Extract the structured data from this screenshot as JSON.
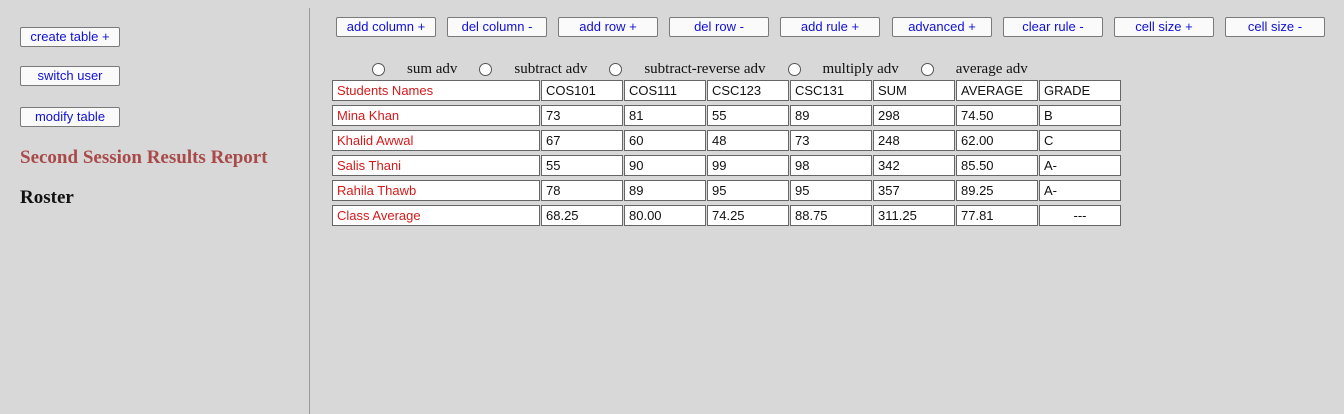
{
  "sidebar": {
    "create_table": "create table +",
    "switch_user": "switch user",
    "modify_table": "modify table",
    "report_title": "Second Session Results Report",
    "roster": "Roster"
  },
  "toolbar": [
    "add column +",
    "del column -",
    "add row +",
    "del row -",
    "add rule +",
    "advanced +",
    "clear rule -",
    "cell size +",
    "cell size -"
  ],
  "advanced_options": [
    "sum adv",
    "subtract adv",
    "subtract-reverse adv",
    "multiply adv",
    "average adv"
  ],
  "table": {
    "headers": [
      "Students Names",
      "COS101",
      "COS111",
      "CSC123",
      "CSC131",
      "SUM",
      "AVERAGE",
      "GRADE"
    ],
    "rows": [
      [
        "Mina Khan",
        "73",
        "81",
        "55",
        "89",
        "298",
        "74.50",
        "B"
      ],
      [
        "Khalid Awwal",
        "67",
        "60",
        "48",
        "73",
        "248",
        "62.00",
        "C"
      ],
      [
        "Salis Thani",
        "55",
        "90",
        "99",
        "98",
        "342",
        "85.50",
        "A-"
      ],
      [
        "Rahila Thawb",
        "78",
        "89",
        "95",
        "95",
        "357",
        "89.25",
        "A-"
      ],
      [
        "Class Average",
        "68.25",
        "80.00",
        "74.25",
        "88.75",
        "311.25",
        "77.81",
        "---"
      ]
    ]
  },
  "colors": {
    "background": "#d8d8d8",
    "button_text": "#1010d8",
    "name_text": "#d41a1a",
    "title_text": "#a84a4a"
  }
}
